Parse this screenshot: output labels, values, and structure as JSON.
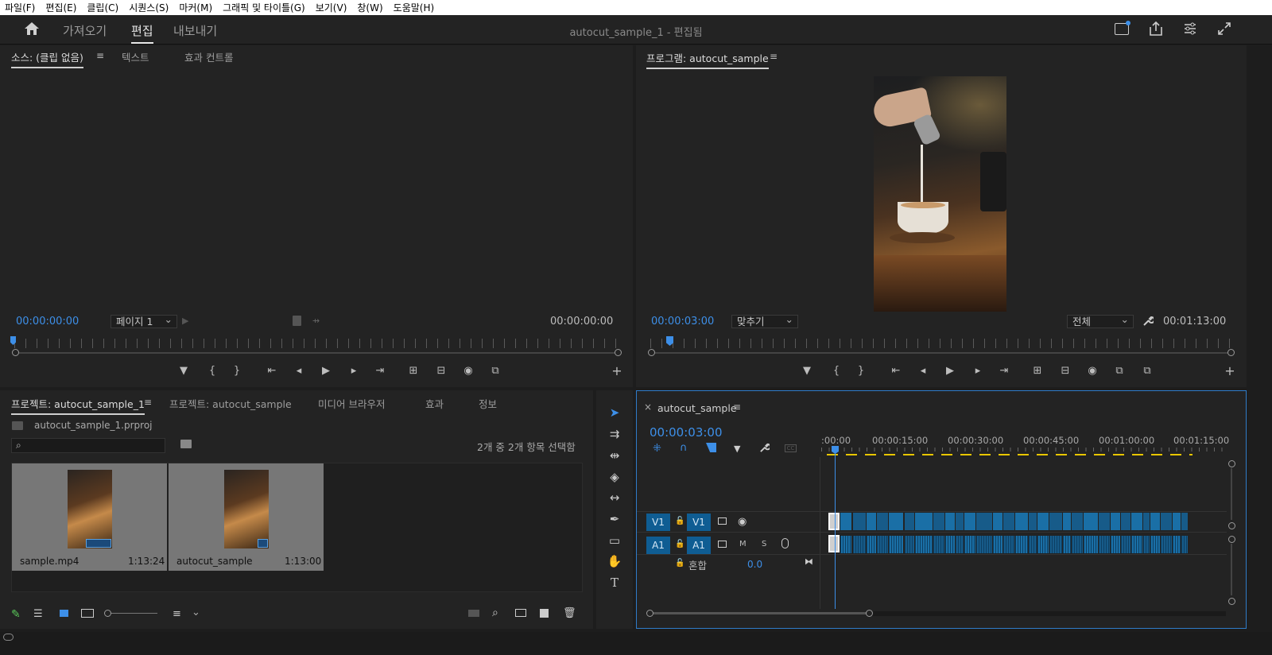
{
  "menu": [
    "파일(F)",
    "편집(E)",
    "클립(C)",
    "시퀀스(S)",
    "마커(M)",
    "그래픽 및 타이틀(G)",
    "보기(V)",
    "창(W)",
    "도움말(H)"
  ],
  "header": {
    "home_icon": "home-icon",
    "workspaces": [
      "가져오기",
      "편집",
      "내보내기"
    ],
    "active_workspace": "편집",
    "title": "autocut_sample_1 - 편집됨",
    "right_icons": [
      "quick-export-icon",
      "share-icon",
      "workspaces-icon",
      "fullscreen-icon"
    ]
  },
  "source": {
    "tabs": [
      "소스: (클립 없음)",
      "텍스트",
      "효과 컨트롤"
    ],
    "menu_icon": "≡",
    "timecode_left": "00:00:00:00",
    "page_select": "페이지 1",
    "timecode_right": "00:00:00:00"
  },
  "program": {
    "title": "프로그램: autocut_sample",
    "menu_icon": "≡",
    "timecode_left": "00:00:03:00",
    "fit_select": "맞추기",
    "quality_select": "전체",
    "timecode_right": "00:01:13:00"
  },
  "transport": {
    "source_icons": [
      "marker-icon",
      "mark-in-icon",
      "mark-out-icon",
      "go-to-in-icon",
      "step-back-icon",
      "play-icon",
      "step-forward-icon",
      "go-to-out-icon",
      "insert-icon",
      "overwrite-icon",
      "export-frame-icon",
      "compare-icon",
      "add-button-icon"
    ],
    "symbols": [
      "▼",
      "{",
      "}",
      "⇤",
      "◂",
      "▶",
      "▸",
      "⇥",
      "⊞",
      "⊟",
      "◉",
      "⧉",
      "+"
    ]
  },
  "project": {
    "tabs": [
      "프로젝트: autocut_sample_1",
      "프로젝트: autocut_sample",
      "미디어 브라우저",
      "효과",
      "정보"
    ],
    "menu_icon": "≡",
    "file": "autocut_sample_1.prproj",
    "selection_info": "2개 중 2개 항목 선택함",
    "items": [
      {
        "name": "sample.mp4",
        "duration": "1:13:24"
      },
      {
        "name": "autocut_sample",
        "duration": "1:13:00"
      }
    ]
  },
  "timeline": {
    "close": "×",
    "name": "autocut_sample",
    "menu_icon": "≡",
    "timecode": "00:00:03:00",
    "ruler_labels": [
      ":00:00",
      "00:00:15:00",
      "00:00:30:00",
      "00:00:45:00",
      "00:01:00:00",
      "00:01:15:00"
    ],
    "tracks": {
      "v1_src": "V1",
      "v1": "V1",
      "a1_src": "A1",
      "a1": "A1",
      "m": "M",
      "s": "S",
      "mix_label": "혼합",
      "mix_value": "0.0"
    }
  },
  "tools": [
    "selection-tool-icon",
    "track-select-icon",
    "ripple-edit-icon",
    "razor-icon",
    "slip-icon",
    "pen-icon",
    "rectangle-icon",
    "hand-icon",
    "type-icon"
  ],
  "colors": {
    "accent": "#3d8fe8",
    "clip": "#175b89",
    "panel": "#232323",
    "bg": "#1d1d1d"
  }
}
